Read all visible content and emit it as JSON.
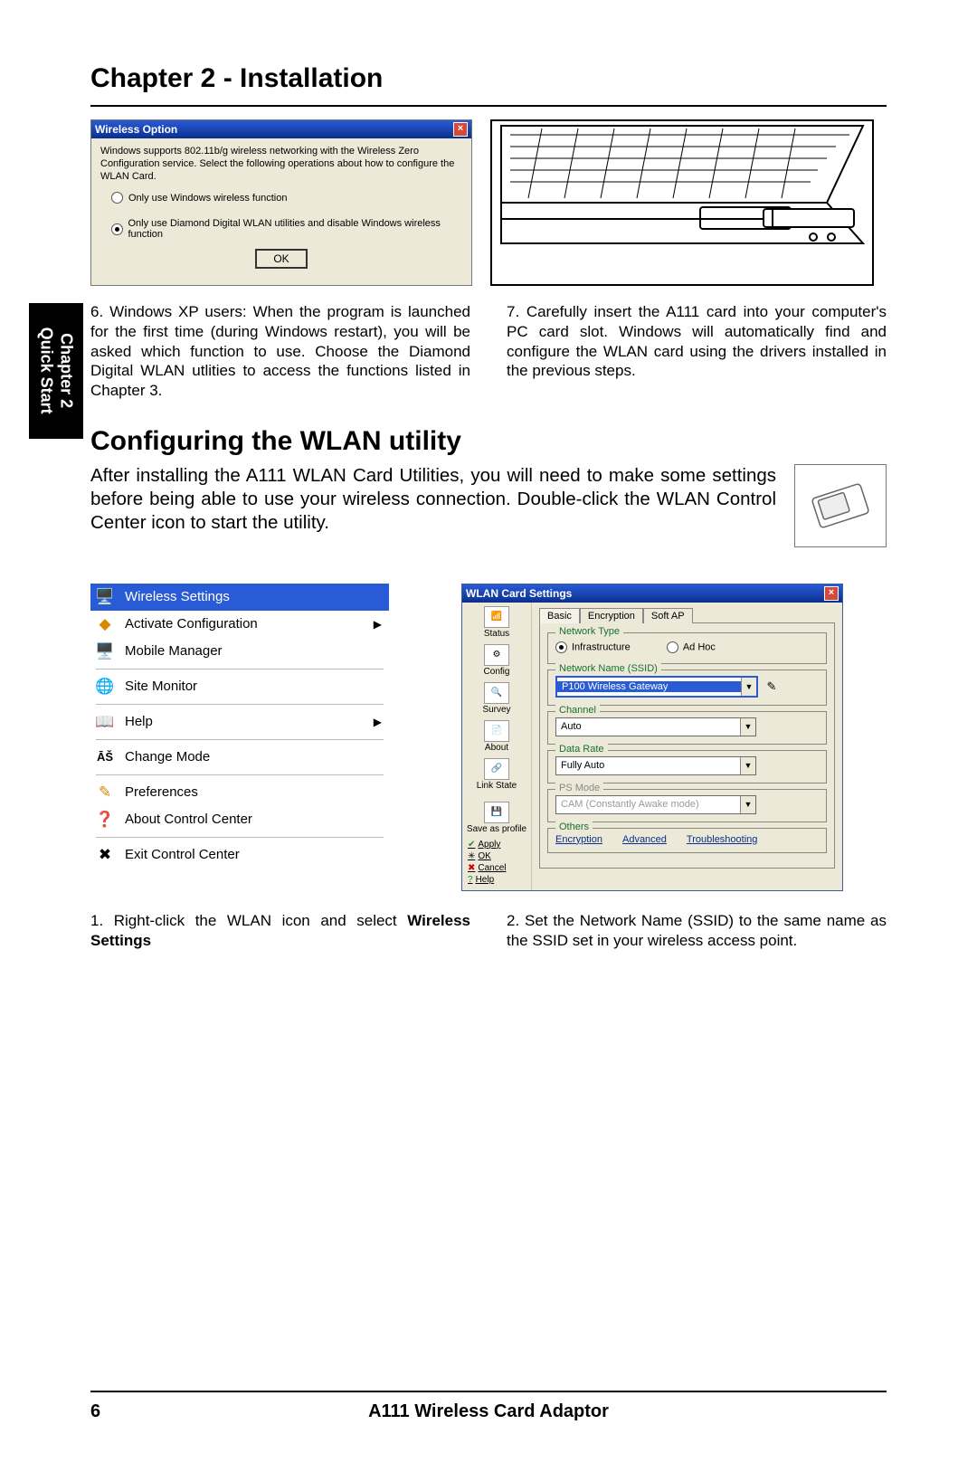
{
  "chapter_title": "Chapter 2 - Installation",
  "side_tab": {
    "line1": "Chapter 2",
    "line2": "Quick Start"
  },
  "dialog": {
    "title": "Wireless Option",
    "desc": "Windows supports 802.11b/g wireless networking with the Wireless Zero Configuration service. Select the following operations about how to configure the WLAN Card.",
    "opt1": "Only use Windows wireless function",
    "opt2": "Only use Diamond Digital WLAN utilities and disable Windows wireless function",
    "ok": "OK"
  },
  "step6": "6. Windows XP users: When the program is launched for the first time (during Windows restart), you will be asked which function to use. Choose the Diamond Digital WLAN utlities to access the functions listed in Chapter 3.",
  "step7": "7. Carefully insert the A111 card into your computer's PC card slot. Windows will automatically find and configure the WLAN card using the drivers installed in the previous steps.",
  "section_heading": "Configuring the WLAN utility",
  "section_text": "After installing the A111 WLAN Card Utilities, you will need to make some settings before being able to use your wireless connection. Double-click the WLAN Control Center icon to start the utility.",
  "menu": {
    "wireless_settings": "Wireless Settings",
    "activate_configuration": "Activate Configuration",
    "mobile_manager": "Mobile Manager",
    "site_monitor": "Site Monitor",
    "help": "Help",
    "change_mode": "Change Mode",
    "preferences": "Preferences",
    "about": "About Control Center",
    "exit": "Exit Control Center"
  },
  "wlan": {
    "title": "WLAN Card Settings",
    "side": {
      "status": "Status",
      "config": "Config",
      "survey": "Survey",
      "about": "About",
      "link_state": "Link State",
      "save_as_profile": "Save as profile",
      "apply": "Apply",
      "ok": "OK",
      "cancel": "Cancel",
      "help": "Help"
    },
    "tabs": {
      "basic": "Basic",
      "encryption": "Encryption",
      "softap": "Soft AP"
    },
    "network_type": {
      "legend": "Network Type",
      "infra": "Infrastructure",
      "adhoc": "Ad Hoc"
    },
    "ssid": {
      "legend": "Network Name (SSID)",
      "value": "P100 Wireless Gateway"
    },
    "channel": {
      "legend": "Channel",
      "value": "Auto"
    },
    "data_rate": {
      "legend": "Data Rate",
      "value": "Fully Auto"
    },
    "ps_mode": {
      "legend": "PS Mode",
      "value": "CAM (Constantly Awake mode)"
    },
    "others": {
      "legend": "Others",
      "encryption": "Encryption",
      "advanced": "Advanced",
      "troubleshooting": "Troubleshooting"
    }
  },
  "step1_a": "1. Right-click the WLAN icon and select ",
  "step1_b": "Wireless Settings",
  "step2": "2. Set the Network Name (SSID) to the same name as the SSID set in your wireless access point.",
  "footer": {
    "page": "6",
    "product": "A111 Wireless Card Adaptor"
  }
}
